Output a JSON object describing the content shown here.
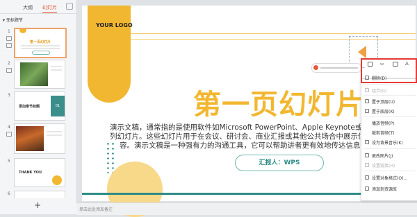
{
  "left_panel": {
    "tabs": [
      "大纲",
      "幻灯片"
    ],
    "section_label": "无标题节",
    "slides": [
      {
        "num": "1",
        "title": "第一页幻灯片"
      },
      {
        "num": "2"
      },
      {
        "num": "3",
        "title": "添加章节标题",
        "badge": "01"
      },
      {
        "num": "4"
      },
      {
        "num": "5",
        "title": "THANK YOU"
      },
      {
        "num": "6"
      }
    ],
    "add_label": "+"
  },
  "slide": {
    "logo": "YOUR LOGO",
    "title": "第一页幻灯片",
    "body_line1": "演示文稿，通常指的是使用软件如Microsoft PowerPoint、Apple Keynote或Goog",
    "body_line2": "列幻灯片。这些幻灯片用于在会议、研讨会、商业汇报或其他公共场合中展示信息",
    "body_line3": "容。演示文稿是一种强有力的沟通工具，它可以帮助讲者更有效地传达信息并",
    "presenter": "汇报人：WPS"
  },
  "notes_placeholder": "单击此处添加备注",
  "context_menu": {
    "items": [
      {
        "label": "删除(D)",
        "enabled": true
      },
      {
        "label": "组合(G)",
        "enabled": false
      },
      {
        "label": "置于顶层(U)",
        "enabled": true
      },
      {
        "label": "置于底层(K)",
        "enabled": true
      },
      {
        "label": "播放音频(P)",
        "enabled": true
      },
      {
        "label": "裁剪音频(T)",
        "enabled": true
      },
      {
        "label": "设为背景音乐(K)",
        "enabled": true
      },
      {
        "label": "更改图片(J)",
        "enabled": true
      },
      {
        "label": "设置链接(H)",
        "enabled": false
      },
      {
        "label": "设置对象格式(O)...",
        "enabled": true
      },
      {
        "label": "添加到资源库",
        "enabled": true
      }
    ]
  },
  "colors": {
    "accent": "#f2b731",
    "teal": "#2d8b86",
    "menu_highlight": "#e53935",
    "tab_active": "#e24b2a"
  }
}
